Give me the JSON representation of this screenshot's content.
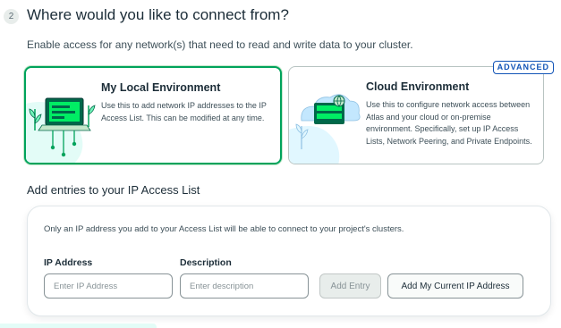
{
  "step": {
    "number": "2",
    "title": "Where would you like to connect from?"
  },
  "description": "Enable access for any network(s) that need to read and write data to your cluster.",
  "options": {
    "local": {
      "title": "My Local Environment",
      "description": "Use this to add network IP addresses to the IP Access List. This can be modified at any time.",
      "selected": true
    },
    "cloud": {
      "title": "Cloud Environment",
      "description": "Use this to configure network access between Atlas and your cloud or on-premise environment. Specifically, set up IP Access Lists, Network Peering, and Private Endpoints.",
      "badge": "ADVANCED",
      "selected": false
    }
  },
  "access_list": {
    "title": "Add entries to your IP Access List",
    "notice": "Only an IP address you add to your Access List will be able to connect to your project's clusters.",
    "ip_label": "IP Address",
    "ip_placeholder": "Enter IP Address",
    "ip_value": "",
    "desc_label": "Description",
    "desc_placeholder": "Enter description",
    "desc_value": "",
    "add_entry_label": "Add Entry",
    "add_current_label": "Add My Current IP Address"
  },
  "colors": {
    "selected_border": "#00a35c",
    "badge_blue": "#1254b7",
    "text_primary": "#1c2d38"
  },
  "icons": [
    "laptop-plants-illustration",
    "cloud-server-illustration"
  ]
}
